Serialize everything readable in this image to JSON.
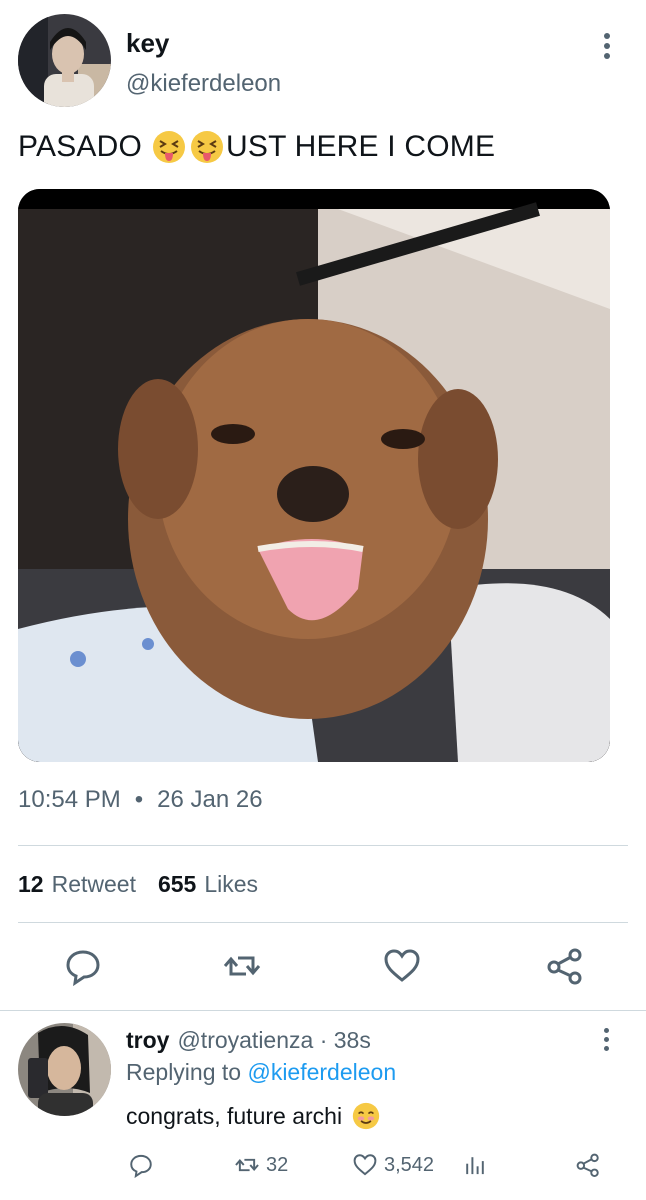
{
  "tweet": {
    "name": "key",
    "handle": "@kieferdeleon",
    "text_before": "PASADO",
    "text_after": "UST HERE I COME",
    "emojis": [
      "squinting-face-with-tongue",
      "squinting-face-with-tongue"
    ],
    "time": "10:54 PM",
    "date": "26 Jan 26",
    "retweets_count": "12",
    "retweets_label": "Retweet",
    "likes_count": "655",
    "likes_label": "Likes",
    "media_icon": "photo-dog-tongue-out"
  },
  "reply": {
    "name": "troy",
    "handle_time": "@troyatienza · 38s",
    "replying_prefix": "Replying to",
    "replying_to": "@kieferdeleon",
    "text": "congrats, future archi",
    "emoji": "smiling-face",
    "retweets": "32",
    "likes": "3,542"
  },
  "colors": {
    "secondary_text": "#536471",
    "link": "#1d9bf0",
    "divider": "#cfd9de"
  }
}
